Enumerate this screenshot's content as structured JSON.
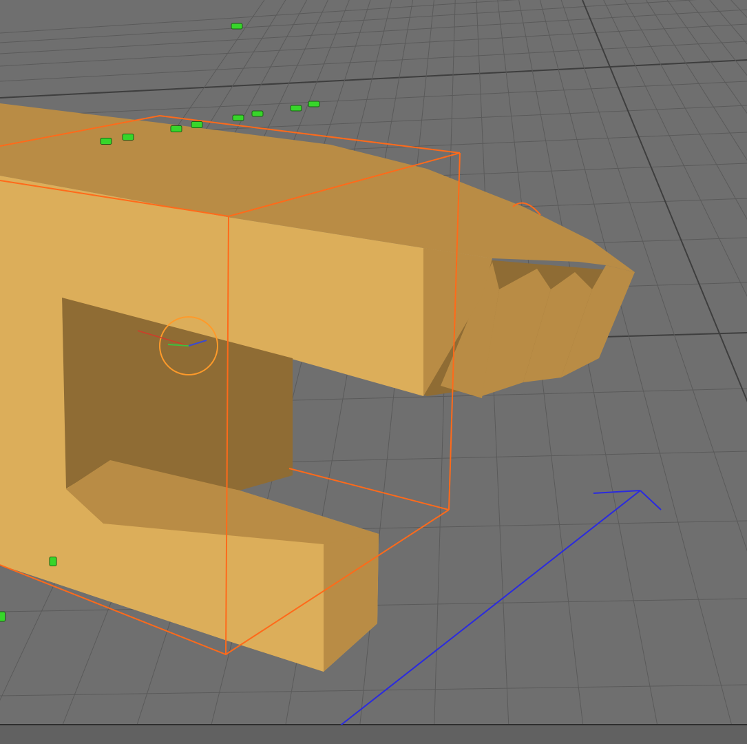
{
  "viewport": {
    "background_color": "#6f6f6f",
    "grid_color": "#5a5a5a",
    "grid_major_color": "#3e3e3e",
    "floor_line_color": "#2a2a2a"
  },
  "scene_object": {
    "shape": "extruded-letter",
    "color_light": "#dcae5a",
    "color_mid": "#b98c45",
    "color_dark": "#8f6c34",
    "selected": true
  },
  "selection": {
    "bbox_color": "#ff6a1a"
  },
  "gizmo": {
    "ring_color": "#ff9a2a",
    "x_axis_color": "#d23a2a",
    "y_axis_color": "#3fbf3f",
    "z_axis_color": "#3a4ad2"
  },
  "world_axis": {
    "color": "#2a2ae0"
  },
  "handles": {
    "color": "#37d62a",
    "outline_color": "#1a5c14"
  }
}
